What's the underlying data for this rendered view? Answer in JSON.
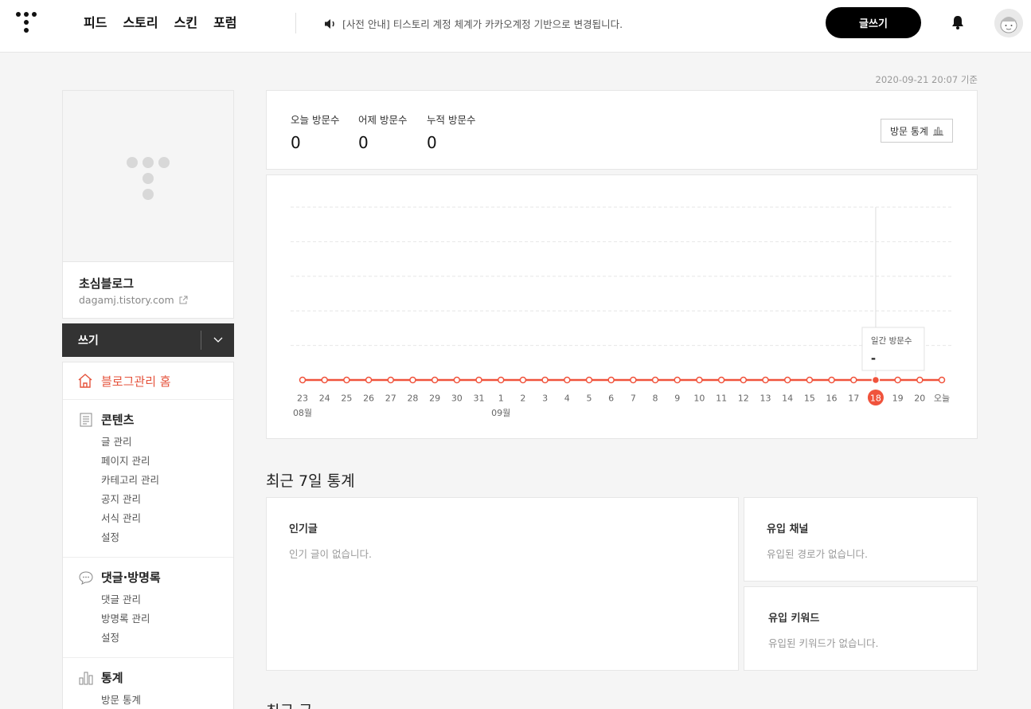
{
  "header": {
    "nav": [
      "피드",
      "스토리",
      "스킨",
      "포럼"
    ],
    "notice": "[사전 안내] 티스토리 계정 체계가 카카오계정 기반으로 변경됩니다.",
    "write_label": "글쓰기",
    "icons": {
      "logo": "tistory-logo",
      "notice": "speaker-icon",
      "bell": "bell-icon",
      "avatar": "avatar"
    }
  },
  "timestamp": "2020-09-21 20:07 기준",
  "profile": {
    "name": "초심블로그",
    "url": "dagamj.tistory.com"
  },
  "write_bar": {
    "label": "쓰기"
  },
  "menu": {
    "home": "블로그관리 홈",
    "sections": [
      {
        "title": "콘텐츠",
        "icon": "document-icon",
        "items": [
          "글 관리",
          "페이지 관리",
          "카테고리 관리",
          "공지 관리",
          "서식 관리",
          "설정"
        ]
      },
      {
        "title": "댓글·방명록",
        "icon": "speech-bubble-icon",
        "items": [
          "댓글 관리",
          "방명록 관리",
          "설정"
        ]
      },
      {
        "title": "통계",
        "icon": "bar-chart-icon",
        "items": [
          "방문 통계"
        ]
      }
    ]
  },
  "stats": {
    "today_label": "오늘 방문수",
    "today_value": "0",
    "yesterday_label": "어제 방문수",
    "yesterday_value": "0",
    "total_label": "누적 방문수",
    "total_value": "0",
    "button_label": "방문 통계"
  },
  "chart_data": {
    "type": "line",
    "x": [
      "23",
      "24",
      "25",
      "26",
      "27",
      "28",
      "29",
      "30",
      "31",
      "1",
      "2",
      "3",
      "4",
      "5",
      "6",
      "7",
      "8",
      "9",
      "10",
      "11",
      "12",
      "13",
      "14",
      "15",
      "16",
      "17",
      "18",
      "19",
      "20",
      "오늘"
    ],
    "month_labels": [
      {
        "index": 0,
        "label": "08월"
      },
      {
        "index": 9,
        "label": "09월"
      }
    ],
    "series": [
      {
        "values": [
          0,
          0,
          0,
          0,
          0,
          0,
          0,
          0,
          0,
          0,
          0,
          0,
          0,
          0,
          0,
          0,
          0,
          0,
          0,
          0,
          0,
          0,
          0,
          0,
          0,
          0,
          0,
          0,
          0,
          0
        ]
      }
    ],
    "highlight_index": 26,
    "tooltip": {
      "label": "일간 방문수",
      "value": "-"
    },
    "grid": true,
    "color": "#f0533c"
  },
  "recent7": {
    "title": "최근 7일 통계",
    "popular": {
      "title": "인기글",
      "empty": "인기 글이 없습니다."
    },
    "channel": {
      "title": "유입 채널",
      "empty": "유입된 경로가 없습니다."
    },
    "keyword": {
      "title": "유입 키워드",
      "empty": "유입된 키워드가 없습니다."
    }
  },
  "recent_posts_title": "최근 글"
}
